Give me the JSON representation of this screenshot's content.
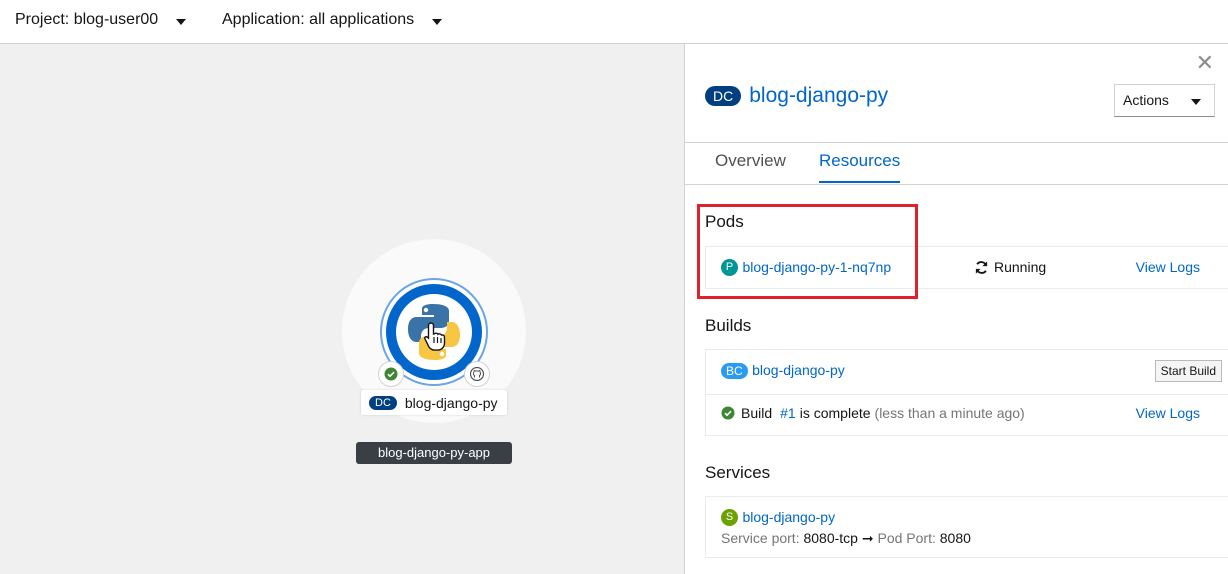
{
  "topbar": {
    "project_label": "Project: blog-user00",
    "application_label": "Application: all applications"
  },
  "topology": {
    "node_kind": "DC",
    "node_name": "blog-django-py",
    "group_name": "blog-django-py-app",
    "node_icon": "python-icon",
    "status_decorator": "check-circle-icon",
    "source_decorator": "github-icon"
  },
  "panel": {
    "kind": "DC",
    "title": "blog-django-py",
    "close_icon": "close-icon",
    "actions_label": "Actions",
    "tabs": [
      {
        "label": "Overview",
        "active": false
      },
      {
        "label": "Resources",
        "active": true
      }
    ],
    "pods": {
      "heading": "Pods",
      "items": [
        {
          "badge": "P",
          "name": "blog-django-py-1-nq7np",
          "status": "Running",
          "logs_label": "View Logs"
        }
      ]
    },
    "builds": {
      "heading": "Builds",
      "config_badge": "BC",
      "config_name": "blog-django-py",
      "start_build_label": "Start Build",
      "latest": {
        "prefix": "Build",
        "number": "#1",
        "status_text": "is complete",
        "time_text": "(less than a minute ago)",
        "logs_label": "View Logs"
      }
    },
    "services": {
      "heading": "Services",
      "items": [
        {
          "badge": "S",
          "name": "blog-django-py",
          "service_port_label": "Service port:",
          "service_port": "8080-tcp",
          "pod_port_label": "Pod Port:",
          "pod_port": "8080"
        }
      ]
    }
  },
  "colors": {
    "accent": "#0066cc",
    "dc_badge": "#004080",
    "pod_badge": "#009596",
    "bc_badge": "#2b9af3",
    "service_badge": "#6ca100",
    "success": "#3e8635",
    "highlight": "#e0202a"
  }
}
